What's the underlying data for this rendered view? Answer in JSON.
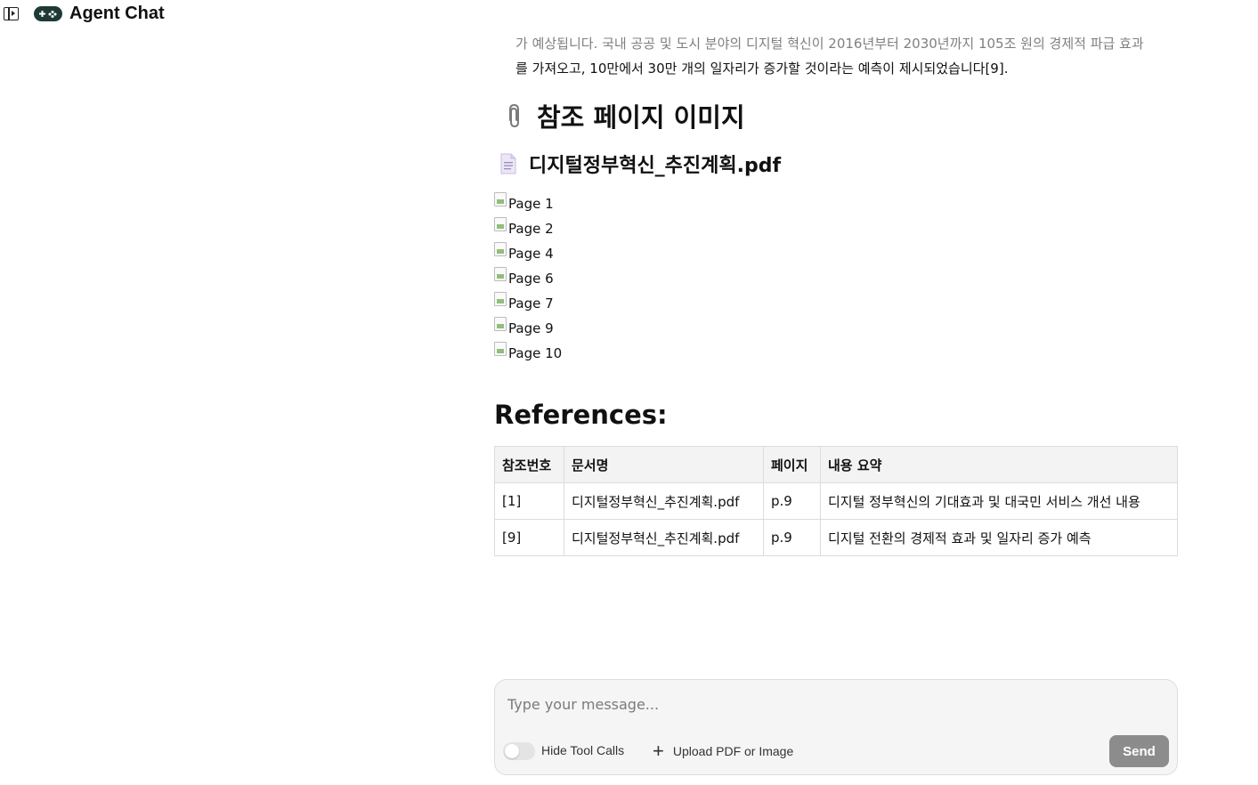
{
  "app": {
    "title": "Agent Chat"
  },
  "message": {
    "para_line1": "가 예상됩니다. 국내 공공 및 도시 분야의 디지털 혁신이 2016년부터 2030년까지 105조 원의 경제적 파급 효과",
    "para_line2": "를 가져오고, 10만에서 30만 개의 일자리가 증가할 것이라는 예측이 제시되었습니다[9].",
    "section_heading": "참조 페이지 이미지",
    "section_icon": "paperclip-icon",
    "file_heading": "디지털정부혁신_추진계획.pdf",
    "file_icon": "document-icon",
    "pages": [
      "Page 1",
      "Page 2",
      "Page 4",
      "Page 6",
      "Page 7",
      "Page 9",
      "Page 10"
    ],
    "references_title": "References:",
    "table": {
      "headers": [
        "참조번호",
        "문서명",
        "페이지",
        "내용 요약"
      ],
      "rows": [
        [
          "[1]",
          "디지털정부혁신_추진계획.pdf",
          "p.9",
          "디지털 정부혁신의 기대효과 및 대국민 서비스 개선 내용"
        ],
        [
          "[9]",
          "디지털정부혁신_추진계획.pdf",
          "p.9",
          "디지털 전환의 경제적 효과 및 일자리 증가 예측"
        ]
      ]
    }
  },
  "composer": {
    "placeholder": "Type your message...",
    "hide_tool_calls_label": "Hide Tool Calls",
    "upload_label": "Upload PDF or Image",
    "send_label": "Send"
  },
  "colors": {
    "logo_bg": "#1f3a36",
    "send_bg": "#8c8c8c",
    "composer_bg": "#f5f5f5",
    "table_header_bg": "#f3f3f3"
  }
}
